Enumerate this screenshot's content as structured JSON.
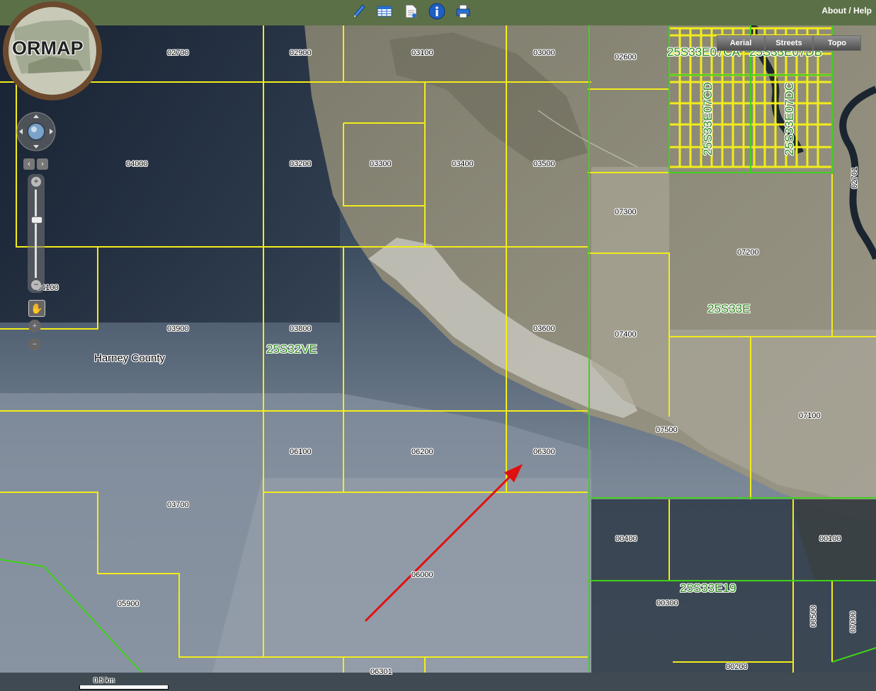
{
  "toolbar": {
    "tools": [
      {
        "name": "pencil-icon",
        "glyph": "✎",
        "color": "#2a6fd0"
      },
      {
        "name": "table-icon",
        "glyph": "▦",
        "color": "#2a6fd0"
      },
      {
        "name": "document-icon",
        "glyph": "🗎",
        "color": "#ffffff"
      },
      {
        "name": "info-icon",
        "glyph": "i",
        "color": "#1f5fc4"
      },
      {
        "name": "printer-icon",
        "glyph": "⎙",
        "color": "#2a6fd0"
      }
    ],
    "about_help": "About / Help"
  },
  "logo": {
    "text": "ORMAP"
  },
  "basemap": {
    "buttons": [
      "Aerial",
      "Streets",
      "Topo"
    ],
    "selected": "Aerial"
  },
  "map": {
    "county": "Harney County",
    "sections": [
      {
        "text": "25S32VE"
      },
      {
        "text": "25S33E"
      },
      {
        "text": "25S33E19"
      },
      {
        "text": "25S33E07CA"
      },
      {
        "text": "25S33E07DB"
      },
      {
        "text": "25S33E07CD"
      },
      {
        "text": "25S33E07DC"
      }
    ],
    "parcels": [
      "02700",
      "02900",
      "03100",
      "03000",
      "02600",
      "04000",
      "03200",
      "03300",
      "03400",
      "03500",
      "02701",
      "07300",
      "07200",
      "04100",
      "03900",
      "03800",
      "03600",
      "07400",
      "07100",
      "07500",
      "06100",
      "06200",
      "06300",
      "03700",
      "00400",
      "00100",
      "06000",
      "05900",
      "00300",
      "00500",
      "07000",
      "00200",
      "06301"
    ],
    "colors": {
      "parcel_line": "#f2ec1a",
      "section_line": "#3fd21a",
      "arrow": "#e01010"
    }
  },
  "scale": {
    "label": "0.5 km"
  }
}
